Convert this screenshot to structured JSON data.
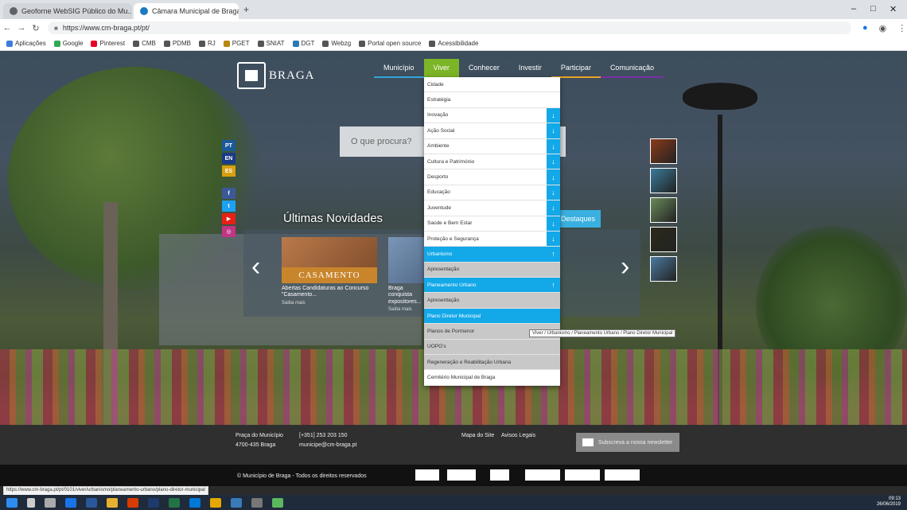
{
  "browser": {
    "tabs": [
      {
        "label": "Geoforne WebSIG Público do Mu..."
      },
      {
        "label": "Câmara Municipal de Braga"
      }
    ],
    "new_tab": "+",
    "window_controls": [
      "–",
      "□",
      "✕"
    ],
    "url": "https://www.cm-braga.pt/pt/",
    "bookmarks": [
      {
        "label": "Aplicações",
        "color": "#3b7ddd"
      },
      {
        "label": "Google",
        "color": "#34a853"
      },
      {
        "label": "Pinterest",
        "color": "#e60023"
      },
      {
        "label": "CMB",
        "color": "#555555"
      },
      {
        "label": "PDMB",
        "color": "#555555"
      },
      {
        "label": "RJ",
        "color": "#555555"
      },
      {
        "label": "PGET",
        "color": "#b8860b"
      },
      {
        "label": "SNIAT",
        "color": "#555555"
      },
      {
        "label": "DGT",
        "color": "#2a7ab8"
      },
      {
        "label": "Webzg",
        "color": "#555555"
      },
      {
        "label": "Portal open source",
        "color": "#555555"
      },
      {
        "label": "Acessibilidade",
        "color": "#555555"
      }
    ]
  },
  "site": {
    "logo_text": "BRAGA",
    "nav": [
      {
        "label": "Município"
      },
      {
        "label": "Viver"
      },
      {
        "label": "Conhecer"
      },
      {
        "label": "Investir"
      },
      {
        "label": "Participar"
      },
      {
        "label": "Comunicação"
      }
    ],
    "search_placeholder": "O que procura?",
    "social": [
      "PT",
      "EN",
      "ES",
      "f",
      "t",
      "▶",
      "◎"
    ],
    "news_title": "Últimas Novidades",
    "news": [
      {
        "banner": "CASAMENTO",
        "caption": "Abertas Candidaturas ao Concurso \"Casamento...",
        "meta": "Saiba mais"
      },
      {
        "banner": "",
        "caption": "Braga conquista expositores...",
        "meta": "Saiba mais"
      }
    ],
    "destaques_label": "Destaques",
    "thumbs": [
      {
        "color": "#8a3a1a"
      },
      {
        "color": "#3a7a9a"
      },
      {
        "color": "#6a8a5a"
      },
      {
        "color": "#2a2a1a"
      },
      {
        "color": "#4a7aa0"
      }
    ],
    "dropdown": [
      {
        "label": "Cidade",
        "style": "plain",
        "icon": ""
      },
      {
        "label": "Estratégia",
        "style": "plain",
        "icon": ""
      },
      {
        "label": "Inovação",
        "style": "plain",
        "icon": "↓"
      },
      {
        "label": "Ação Social",
        "style": "plain",
        "icon": "↓"
      },
      {
        "label": "Ambiente",
        "style": "plain",
        "icon": "↓"
      },
      {
        "label": "Cultura e Património",
        "style": "plain",
        "icon": "↓"
      },
      {
        "label": "Desporto",
        "style": "plain",
        "icon": "↓"
      },
      {
        "label": "Educação",
        "style": "plain",
        "icon": "↓"
      },
      {
        "label": "Juventude",
        "style": "plain",
        "icon": "↓"
      },
      {
        "label": "Saúde e Bem Estar",
        "style": "plain",
        "icon": "↓"
      },
      {
        "label": "Proteção e Segurança",
        "style": "plain",
        "icon": "↓"
      },
      {
        "label": "Urbanismo",
        "style": "blue",
        "icon": "↑"
      },
      {
        "label": "Apresentação",
        "style": "grey",
        "icon": ""
      },
      {
        "label": "Planeamento Urbano",
        "style": "blue",
        "icon": "↑"
      },
      {
        "label": "Apresentação",
        "style": "grey",
        "icon": ""
      },
      {
        "label": "Plano Diretor Municipal",
        "style": "hover",
        "icon": ""
      },
      {
        "label": "Planos de Pormenor",
        "style": "grey",
        "icon": ""
      },
      {
        "label": "UOPG's",
        "style": "grey",
        "icon": ""
      },
      {
        "label": "Regeneração e Reabilitação Urbana",
        "style": "grey",
        "icon": ""
      },
      {
        "label": "Cemitério Municipal de Braga",
        "style": "plain",
        "icon": ""
      }
    ],
    "tooltip": "Viver / Urbanismo / Planeamento Urbano / Plano Diretor Municipal",
    "footer": {
      "address_line1": "Praça do Município",
      "address_line2": "4700-435 Braga",
      "phone": "[+351] 253 203 150",
      "email": "municipe@cm-braga.pt",
      "sitemap": "Mapa do Site",
      "legal": "Avisos Legais",
      "newsletter": "Subscreva a nossa newsletter",
      "copyright": "© Município de Braga - Todos os direitos reservados"
    }
  },
  "status_url": "https://www.cm-braga.pt/pt/0101/viver/urbanismo/planeamento-urbano/plano-diretor-municipal",
  "tray": {
    "time": "09:13",
    "date": "26/06/2019"
  }
}
